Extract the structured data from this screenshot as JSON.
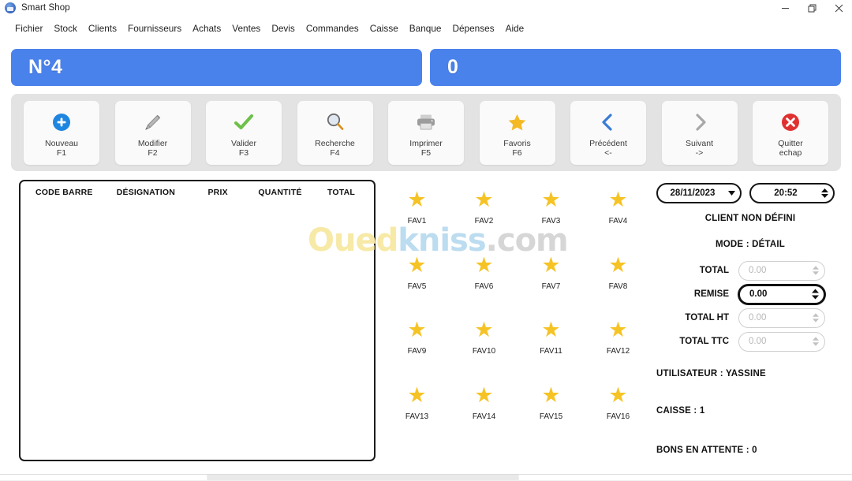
{
  "window": {
    "title": "Smart Shop",
    "app_icon": "app-globe-icon",
    "minimize": "minimize-icon",
    "maximize": "restore-icon",
    "close": "close-icon"
  },
  "menubar": {
    "items": [
      {
        "label": "Fichier"
      },
      {
        "label": "Stock"
      },
      {
        "label": "Clients"
      },
      {
        "label": "Fournisseurs"
      },
      {
        "label": "Achats"
      },
      {
        "label": "Ventes"
      },
      {
        "label": "Devis"
      },
      {
        "label": "Commandes"
      },
      {
        "label": "Caisse"
      },
      {
        "label": "Banque"
      },
      {
        "label": "Dépenses"
      },
      {
        "label": "Aide"
      }
    ]
  },
  "header_bars": {
    "accent_color": "#4a82ec",
    "left_value": "N°4",
    "right_value": "0"
  },
  "toolbar": {
    "background": "#e3e3e3",
    "buttons": [
      {
        "label": "Nouveau",
        "key": "F1",
        "icon": "plus-circle-icon",
        "color": "#1f86e0"
      },
      {
        "label": "Modifier",
        "key": "F2",
        "icon": "pencil-icon",
        "color": "#8c8c8c"
      },
      {
        "label": "Valider",
        "key": "F3",
        "icon": "check-icon",
        "color": "#6dc04a"
      },
      {
        "label": "Recherche",
        "key": "F4",
        "icon": "magnifier-icon",
        "color": "#7a7a7a"
      },
      {
        "label": "Imprimer",
        "key": "F5",
        "icon": "printer-icon",
        "color": "#9a9a9a"
      },
      {
        "label": "Favoris",
        "key": "F6",
        "icon": "star-icon",
        "color": "#f5b924"
      },
      {
        "label": "Précédent",
        "key": "<-",
        "icon": "chevron-left-icon",
        "color": "#3a7bd5"
      },
      {
        "label": "Suivant",
        "key": "->",
        "icon": "chevron-right-icon",
        "color": "#a8a8a8"
      },
      {
        "label": "Quitter",
        "key": "echap",
        "icon": "close-circle-icon",
        "color": "#e03131"
      }
    ]
  },
  "grid": {
    "columns": [
      "CODE BARRE",
      "DÉSIGNATION",
      "PRIX",
      "QUANTITÉ",
      "TOTAL"
    ],
    "rows": []
  },
  "favorites": {
    "items": [
      {
        "label": "FAV1",
        "icon": "star-icon"
      },
      {
        "label": "FAV2",
        "icon": "star-icon"
      },
      {
        "label": "FAV3",
        "icon": "star-icon"
      },
      {
        "label": "FAV4",
        "icon": "star-icon"
      },
      {
        "label": "FAV5",
        "icon": "star-icon"
      },
      {
        "label": "FAV6",
        "icon": "star-icon"
      },
      {
        "label": "FAV7",
        "icon": "star-icon"
      },
      {
        "label": "FAV8",
        "icon": "star-icon"
      },
      {
        "label": "FAV9",
        "icon": "star-icon"
      },
      {
        "label": "FAV10",
        "icon": "star-icon"
      },
      {
        "label": "FAV11",
        "icon": "star-icon"
      },
      {
        "label": "FAV12",
        "icon": "star-icon"
      },
      {
        "label": "FAV13",
        "icon": "star-icon"
      },
      {
        "label": "FAV14",
        "icon": "star-icon"
      },
      {
        "label": "FAV15",
        "icon": "star-icon"
      },
      {
        "label": "FAV16",
        "icon": "star-icon"
      }
    ],
    "star_color": "#f6c324"
  },
  "side_panel": {
    "date_value": "28/11/2023",
    "time_value": "20:52",
    "client_line": "CLIENT NON DÉFINI",
    "mode_line": "MODE : DÉTAIL",
    "amounts": [
      {
        "label": "TOTAL",
        "value": "0.00",
        "focused": false
      },
      {
        "label": "REMISE",
        "value": "0.00",
        "focused": true
      },
      {
        "label": "TOTAL HT",
        "value": "0.00",
        "focused": false
      },
      {
        "label": "TOTAL TTC",
        "value": "0.00",
        "focused": false
      }
    ],
    "user_line": "UTILISATEUR : YASSINE",
    "caisse_line": "CAISSE : 1",
    "pending_line": "BONS EN ATTENTE : 0"
  },
  "watermark": {
    "part1": "Oued",
    "part2": "kniss",
    "part3": ".com"
  }
}
